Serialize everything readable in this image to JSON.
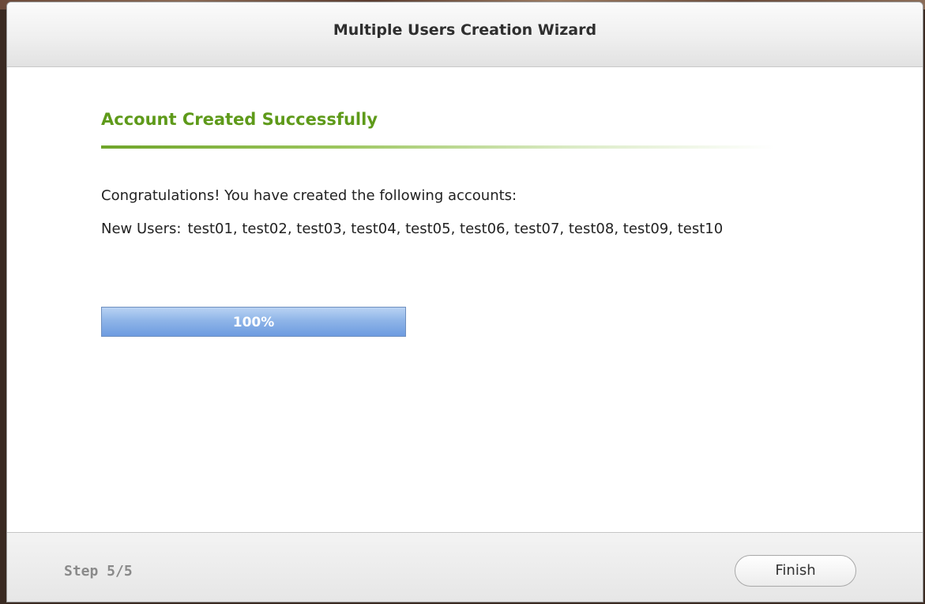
{
  "window": {
    "title": "Multiple Users Creation Wizard"
  },
  "content": {
    "section_title": "Account Created Successfully",
    "message": "Congratulations! You have created the following accounts:",
    "users_label": "New Users:",
    "users_list": "test01, test02, test03, test04, test05, test06, test07, test08, test09, test10",
    "progress": {
      "percent": 100,
      "label": "100%"
    }
  },
  "footer": {
    "step": "Step 5/5",
    "finish_label": "Finish"
  },
  "colors": {
    "accent_green": "#5e9a1a",
    "progress_blue": "#8fb5e8"
  }
}
